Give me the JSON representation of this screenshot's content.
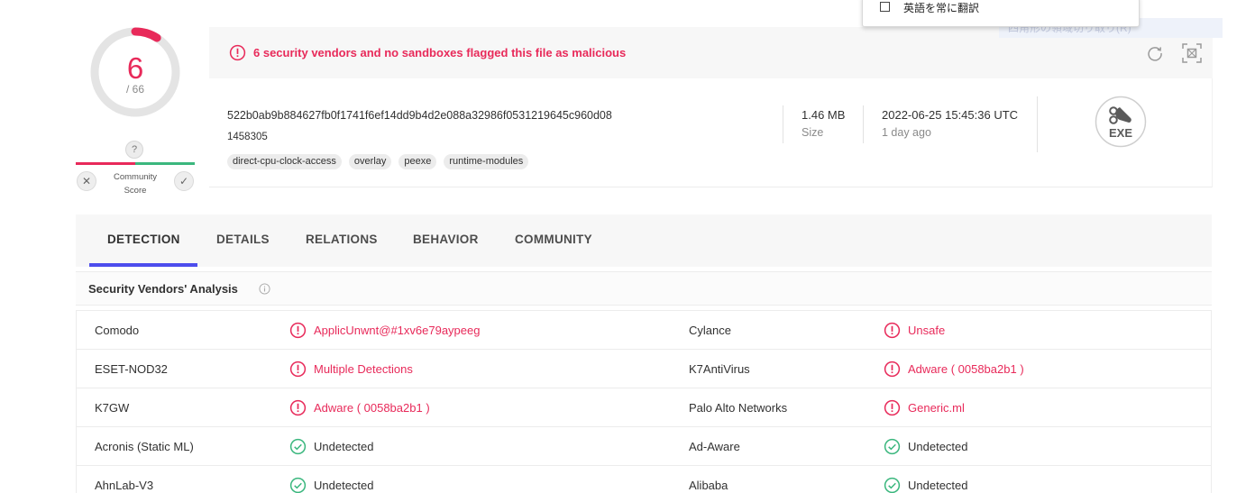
{
  "summary": {
    "score": "6",
    "total": "/ 66",
    "score_fraction": 0.09,
    "community_help": "?",
    "community_label": "Community Score",
    "community_vote_down": "✕",
    "community_vote_up": "✓"
  },
  "alert": {
    "text": "6 security vendors and no sandboxes flagged this file as malicious",
    "ghost_text": "四角形の領域切り取り(R)"
  },
  "file": {
    "hash": "522b0ab9b884627fb0f1741f6ef14dd9b4d2e088a32986f0531219645c960d08",
    "name": "1458305",
    "tags": [
      "direct-cpu-clock-access",
      "overlay",
      "peexe",
      "runtime-modules"
    ],
    "size_value": "1.46 MB",
    "size_label": "Size",
    "date_value": "2022-06-25 15:45:36 UTC",
    "date_ago": "1 day ago",
    "type_label": "EXE"
  },
  "translate_menu": {
    "label": "英語を常に翻訳"
  },
  "tabs": [
    {
      "label": "DETECTION"
    },
    {
      "label": "DETAILS"
    },
    {
      "label": "RELATIONS"
    },
    {
      "label": "BEHAVIOR"
    },
    {
      "label": "COMMUNITY"
    }
  ],
  "section": {
    "title": "Security Vendors' Analysis"
  },
  "detections": [
    {
      "l_vendor": "Comodo",
      "l_result": "ApplicUnwnt@#1xv6e79aypeeg",
      "l_status": "malicious",
      "r_vendor": "Cylance",
      "r_result": "Unsafe",
      "r_status": "malicious"
    },
    {
      "l_vendor": "ESET-NOD32",
      "l_result": "Multiple Detections",
      "l_status": "malicious",
      "r_vendor": "K7AntiVirus",
      "r_result": "Adware ( 0058ba2b1 )",
      "r_status": "malicious"
    },
    {
      "l_vendor": "K7GW",
      "l_result": "Adware ( 0058ba2b1 )",
      "l_status": "malicious",
      "r_vendor": "Palo Alto Networks",
      "r_result": "Generic.ml",
      "r_status": "malicious"
    },
    {
      "l_vendor": "Acronis (Static ML)",
      "l_result": "Undetected",
      "l_status": "clean",
      "r_vendor": "Ad-Aware",
      "r_result": "Undetected",
      "r_status": "clean"
    },
    {
      "l_vendor": "AhnLab-V3",
      "l_result": "Undetected",
      "l_status": "clean",
      "r_vendor": "Alibaba",
      "r_result": "Undetected",
      "r_status": "clean"
    }
  ],
  "colors": {
    "malicious": "#e82a5a",
    "clean": "#3bb77e",
    "accent": "#4d4ded"
  }
}
